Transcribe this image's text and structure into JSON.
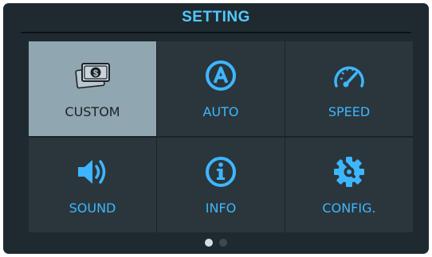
{
  "header": {
    "title": "SETTING"
  },
  "menu": {
    "tiles": [
      {
        "label": "CUSTOM",
        "icon": "money-icon",
        "selected": true
      },
      {
        "label": "AUTO",
        "icon": "auto-mode-icon",
        "selected": false
      },
      {
        "label": "SPEED",
        "icon": "speedometer-icon",
        "selected": false
      },
      {
        "label": "SOUND",
        "icon": "speaker-icon",
        "selected": false
      },
      {
        "label": "INFO",
        "icon": "info-icon",
        "selected": false
      },
      {
        "label": "CONFIG.",
        "icon": "gear-wrench-icon",
        "selected": false
      }
    ]
  },
  "pagination": {
    "current_page": 1,
    "total_pages": 2
  },
  "colors": {
    "background": "#1e2a30",
    "tile": "#2a363c",
    "tile_selected": "#90a6b0",
    "accent": "#3eb6ff",
    "title": "#55c8ff"
  }
}
